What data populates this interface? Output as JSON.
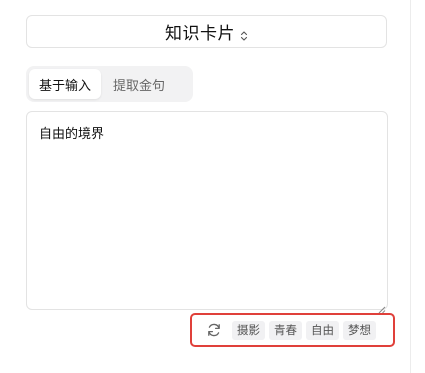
{
  "card_selector": {
    "label": "知识卡片",
    "icon": "chevron-up-down-icon"
  },
  "tabs": [
    {
      "label": "基于输入",
      "active": true
    },
    {
      "label": "提取金句",
      "active": false
    }
  ],
  "input": {
    "value": "自由的境界"
  },
  "tags": {
    "refresh_icon": "refresh-icon",
    "items": [
      "摄影",
      "青春",
      "自由",
      "梦想"
    ]
  },
  "colors": {
    "highlight_border": "#e0403a",
    "tab_bg": "#f2f2f3",
    "tag_bg": "#f1f1f3"
  }
}
